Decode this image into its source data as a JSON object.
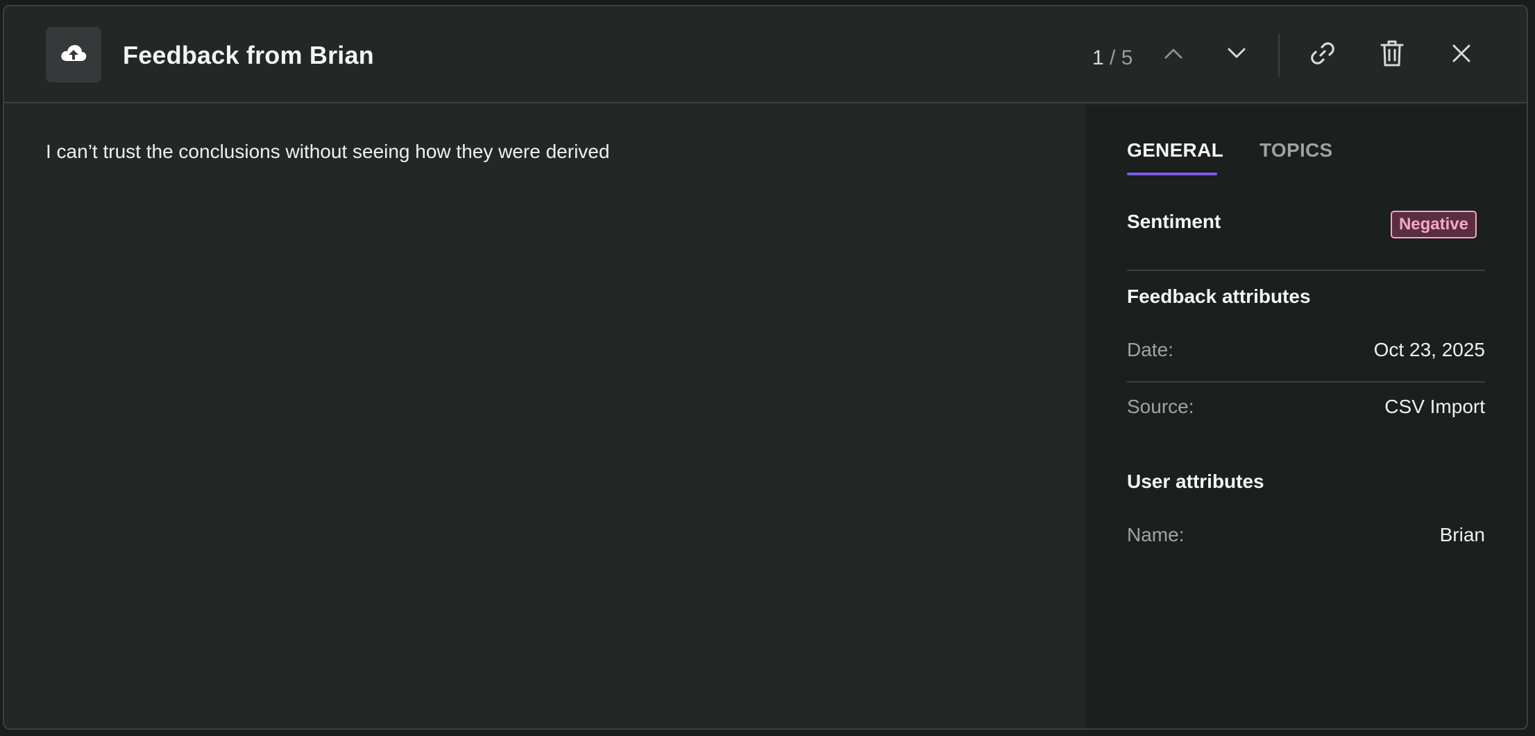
{
  "header": {
    "title": "Feedback from Brian",
    "counter_current": "1",
    "counter_sep": "/",
    "counter_total": "5",
    "icons": [
      "upload-cloud-icon",
      "chevron-up-icon",
      "chevron-down-icon",
      "link-icon",
      "trash-icon",
      "close-icon"
    ]
  },
  "feedback": {
    "text": "I can’t trust the conclusions without seeing how they were derived"
  },
  "sidebar": {
    "tabs": [
      {
        "label": "GENERAL",
        "active": true
      },
      {
        "label": "TOPICS",
        "active": false
      }
    ],
    "sentiment": {
      "label": "Sentiment",
      "value": "Negative"
    },
    "feedback_attributes": {
      "title": "Feedback attributes",
      "date_label": "Date:",
      "date_value": "Oct 23, 2025",
      "source_label": "Source:",
      "source_value": "CSV Import"
    },
    "user_attributes": {
      "title": "User attributes",
      "name_label": "Name:",
      "name_value": "Brian"
    }
  },
  "colors": {
    "accent": "#7b5ce6",
    "negative_badge_text": "#f5a9c8",
    "negative_badge_border": "#f2a7c6"
  }
}
